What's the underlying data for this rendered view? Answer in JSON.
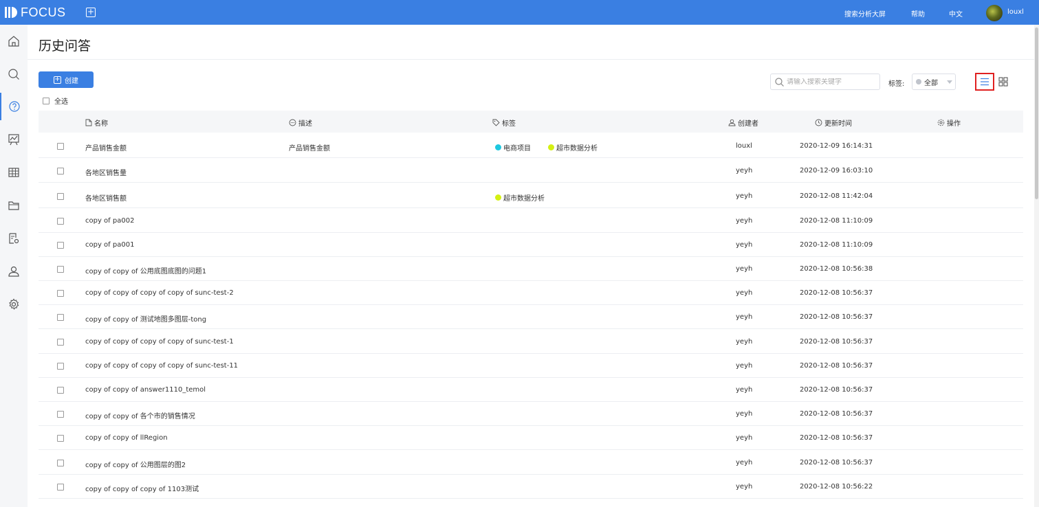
{
  "brand": {
    "logo_text": "FOCUS"
  },
  "topbar": {
    "add_icon": "plus-square-icon",
    "links": [
      "搜索分析大屏",
      "帮助",
      "中文"
    ],
    "username": "louxl"
  },
  "sidebar": {
    "items": [
      {
        "icon": "home-icon",
        "active": false
      },
      {
        "icon": "search-icon",
        "active": false
      },
      {
        "icon": "question-circle-icon",
        "active": true
      },
      {
        "icon": "dashboard-chart-icon",
        "active": false
      },
      {
        "icon": "table-icon",
        "active": false
      },
      {
        "icon": "folder-icon",
        "active": false
      },
      {
        "icon": "file-settings-icon",
        "active": false
      },
      {
        "icon": "user-icon",
        "active": false
      },
      {
        "icon": "gear-icon",
        "active": false
      }
    ]
  },
  "page": {
    "title": "历史问答"
  },
  "toolbar": {
    "create_label": "创建",
    "select_all_label": "全选",
    "search_placeholder": "请输入搜索关键字",
    "tag_label": "标签:",
    "tag_select_value": "全部"
  },
  "table": {
    "columns": {
      "name": "名称",
      "desc": "描述",
      "tags": "标签",
      "creator": "创建者",
      "updated": "更新时间",
      "actions": "操作"
    },
    "tag_colors": {
      "电商项目": "#1ec8e0",
      "超市数据分析": "#d4f012"
    },
    "rows": [
      {
        "name": "产品销售金额",
        "desc": "产品销售金额",
        "tags": [
          "电商项目",
          "超市数据分析"
        ],
        "creator": "louxl",
        "updated": "2020-12-09 16:14:31"
      },
      {
        "name": "各地区销售量",
        "desc": "",
        "tags": [],
        "creator": "yeyh",
        "updated": "2020-12-09 16:03:10"
      },
      {
        "name": "各地区销售额",
        "desc": "",
        "tags": [
          "超市数据分析"
        ],
        "creator": "yeyh",
        "updated": "2020-12-08 11:42:04"
      },
      {
        "name": "copy of pa002",
        "desc": "",
        "tags": [],
        "creator": "yeyh",
        "updated": "2020-12-08 11:10:09"
      },
      {
        "name": "copy of pa001",
        "desc": "",
        "tags": [],
        "creator": "yeyh",
        "updated": "2020-12-08 11:10:09"
      },
      {
        "name": "copy of copy of 公用底图底图的问题1",
        "desc": "",
        "tags": [],
        "creator": "yeyh",
        "updated": "2020-12-08 10:56:38"
      },
      {
        "name": "copy of copy of copy of copy of sunc-test-2",
        "desc": "",
        "tags": [],
        "creator": "yeyh",
        "updated": "2020-12-08 10:56:37"
      },
      {
        "name": "copy of copy of 测试地图多图层-tong",
        "desc": "",
        "tags": [],
        "creator": "yeyh",
        "updated": "2020-12-08 10:56:37"
      },
      {
        "name": "copy of copy of copy of copy of sunc-test-1",
        "desc": "",
        "tags": [],
        "creator": "yeyh",
        "updated": "2020-12-08 10:56:37"
      },
      {
        "name": "copy of copy of copy of copy of sunc-test-11",
        "desc": "",
        "tags": [],
        "creator": "yeyh",
        "updated": "2020-12-08 10:56:37"
      },
      {
        "name": "copy of copy of answer1110_temol",
        "desc": "",
        "tags": [],
        "creator": "yeyh",
        "updated": "2020-12-08 10:56:37"
      },
      {
        "name": "copy of copy of 各个市的销售情况",
        "desc": "",
        "tags": [],
        "creator": "yeyh",
        "updated": "2020-12-08 10:56:37"
      },
      {
        "name": "copy of copy of llRegion",
        "desc": "",
        "tags": [],
        "creator": "yeyh",
        "updated": "2020-12-08 10:56:37"
      },
      {
        "name": "copy of copy of 公用图层的图2",
        "desc": "",
        "tags": [],
        "creator": "yeyh",
        "updated": "2020-12-08 10:56:37"
      },
      {
        "name": "copy of copy of copy of 1103测试",
        "desc": "",
        "tags": [],
        "creator": "yeyh",
        "updated": "2020-12-08 10:56:22"
      }
    ]
  }
}
